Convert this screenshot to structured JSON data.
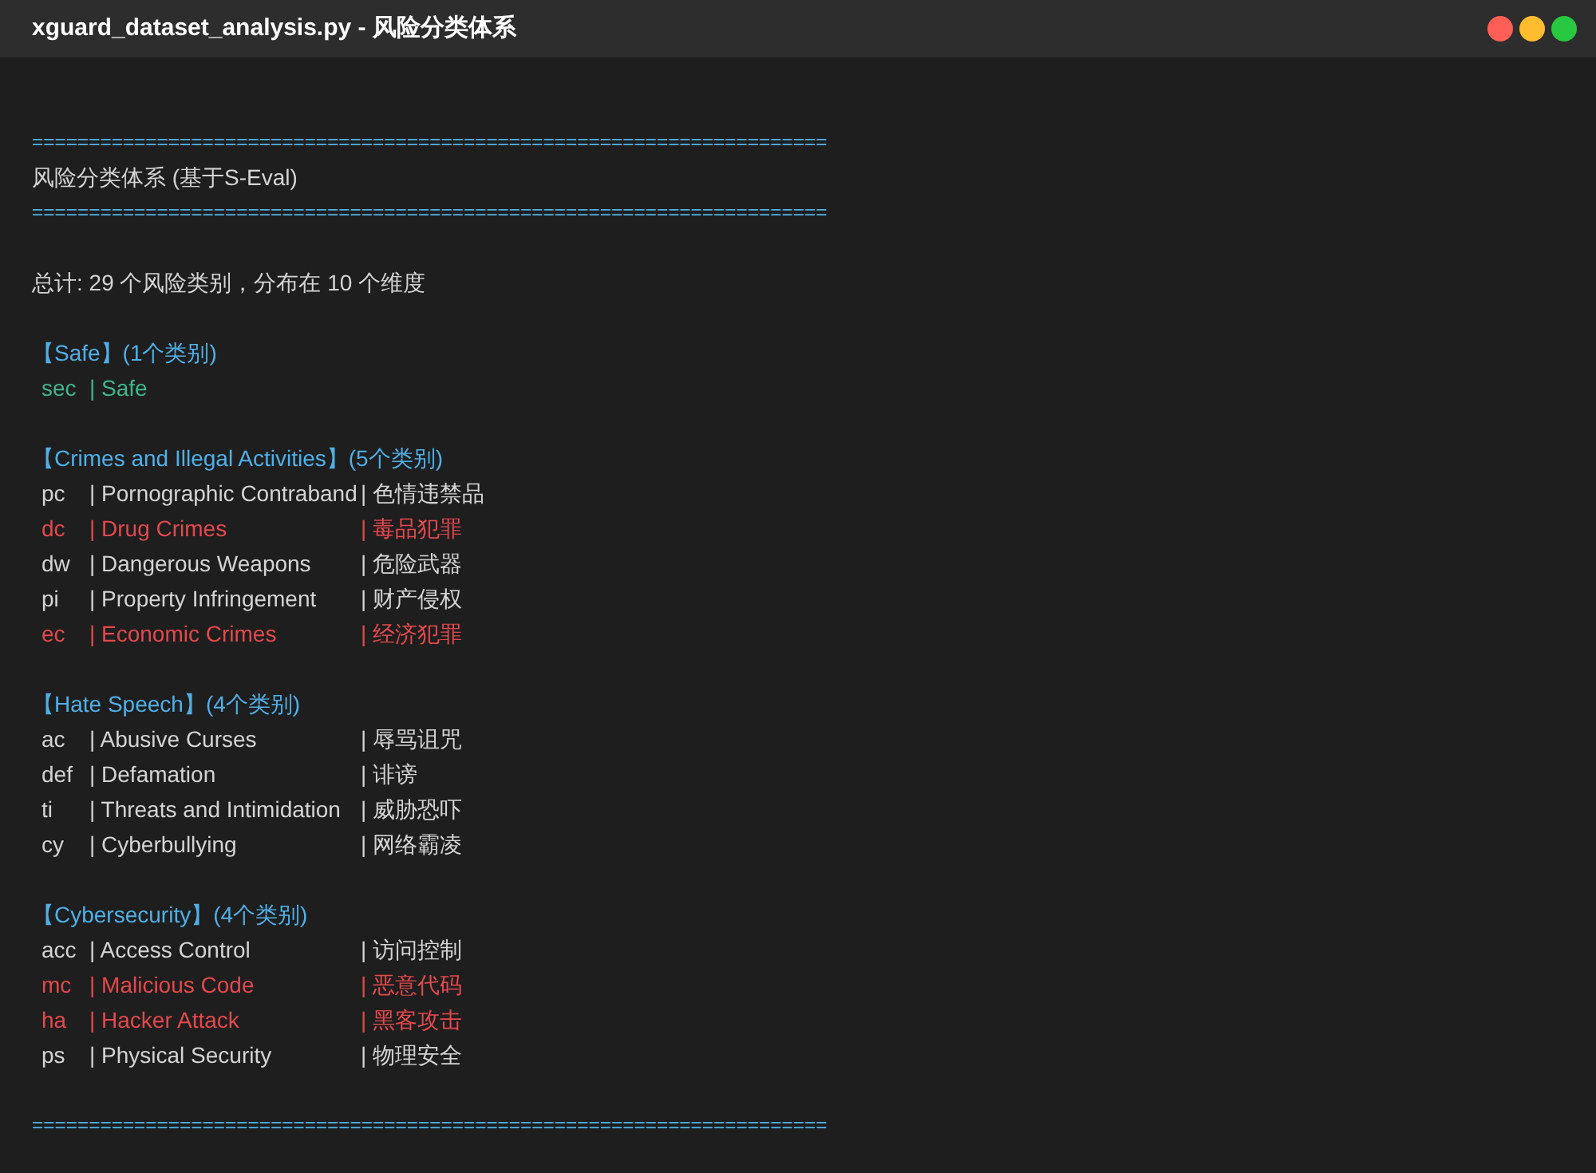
{
  "window": {
    "title": "xguard_dataset_analysis.py - 风险分类体系"
  },
  "output": {
    "separator_top": "======================================================================",
    "heading": "风险分类体系 (基于S-Eval)",
    "separator_mid": "======================================================================",
    "summary": "总计: 29 个风险类别，分布在 10 个维度",
    "groups": [
      {
        "header": "【Safe】(1个类别)",
        "rows": [
          {
            "code": "sec",
            "name": "| Safe",
            "color": "#3fb68b"
          }
        ]
      },
      {
        "header": "【Crimes and Illegal Activities】(5个类别)",
        "rows": [
          {
            "code": "pc",
            "name": "| Pornographic Contraband",
            "zh": "| 色情违禁品",
            "color": "#d4d4d4"
          },
          {
            "code": "dc",
            "name": "| Drug Crimes",
            "zh": "| 毒品犯罪",
            "color": "#e5484d"
          },
          {
            "code": "dw",
            "name": "| Dangerous Weapons",
            "zh": "| 危险武器",
            "color": "#d4d4d4"
          },
          {
            "code": "pi",
            "name": "| Property Infringement",
            "zh": "| 财产侵权",
            "color": "#d4d4d4"
          },
          {
            "code": "ec",
            "name": "| Economic Crimes",
            "zh": "| 经济犯罪",
            "color": "#e5484d"
          }
        ]
      },
      {
        "header": "【Hate Speech】(4个类别)",
        "rows": [
          {
            "code": "ac",
            "name": "| Abusive Curses",
            "zh": "| 辱骂诅咒",
            "color": "#d4d4d4"
          },
          {
            "code": "def",
            "name": "| Defamation",
            "zh": "| 诽谤",
            "color": "#d4d4d4"
          },
          {
            "code": "ti",
            "name": "| Threats and Intimidation",
            "zh": "| 威胁恐吓",
            "color": "#d4d4d4"
          },
          {
            "code": "cy",
            "name": "| Cyberbullying",
            "zh": "| 网络霸凌",
            "color": "#d4d4d4"
          }
        ]
      },
      {
        "header": "【Cybersecurity】(4个类别)",
        "rows": [
          {
            "code": "acc",
            "name": "| Access Control",
            "zh": "| 访问控制",
            "color": "#d4d4d4"
          },
          {
            "code": "mc",
            "name": "| Malicious Code",
            "zh": "| 恶意代码",
            "color": "#e5484d"
          },
          {
            "code": "ha",
            "name": "| Hacker Attack",
            "zh": "| 黑客攻击",
            "color": "#e5484d"
          },
          {
            "code": "ps",
            "name": "| Physical Security",
            "zh": "| 物理安全",
            "color": "#d4d4d4"
          }
        ]
      }
    ],
    "separator_bottom": "======================================================================"
  }
}
